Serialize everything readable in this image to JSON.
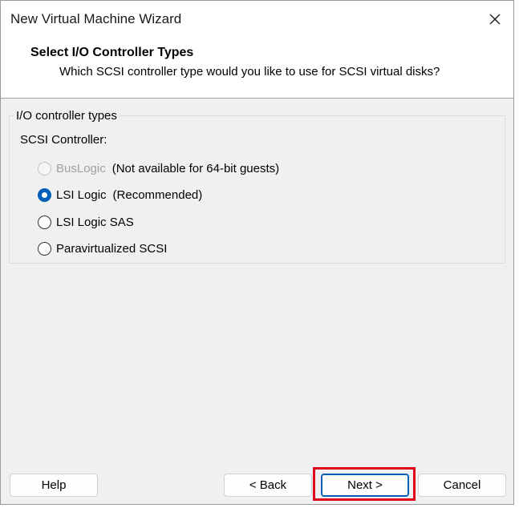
{
  "window": {
    "title": "New Virtual Machine Wizard"
  },
  "header": {
    "title": "Select I/O Controller Types",
    "subtitle": "Which SCSI controller type would you like to use for SCSI virtual disks?"
  },
  "group": {
    "legend": "I/O controller types",
    "scsi_label": "SCSI Controller:",
    "options": [
      {
        "label": "BusLogic",
        "note": "(Not available for 64-bit guests)",
        "checked": false,
        "disabled": true
      },
      {
        "label": "LSI Logic",
        "note": "(Recommended)",
        "checked": true,
        "disabled": false
      },
      {
        "label": "LSI Logic SAS",
        "note": "",
        "checked": false,
        "disabled": false
      },
      {
        "label": "Paravirtualized SCSI",
        "note": "",
        "checked": false,
        "disabled": false
      }
    ]
  },
  "buttons": {
    "help": "Help",
    "back": "< Back",
    "next": "Next >",
    "cancel": "Cancel"
  },
  "colors": {
    "accent": "#005fb8",
    "highlight": "#e0001b"
  },
  "icons": {
    "close": "close-icon"
  }
}
